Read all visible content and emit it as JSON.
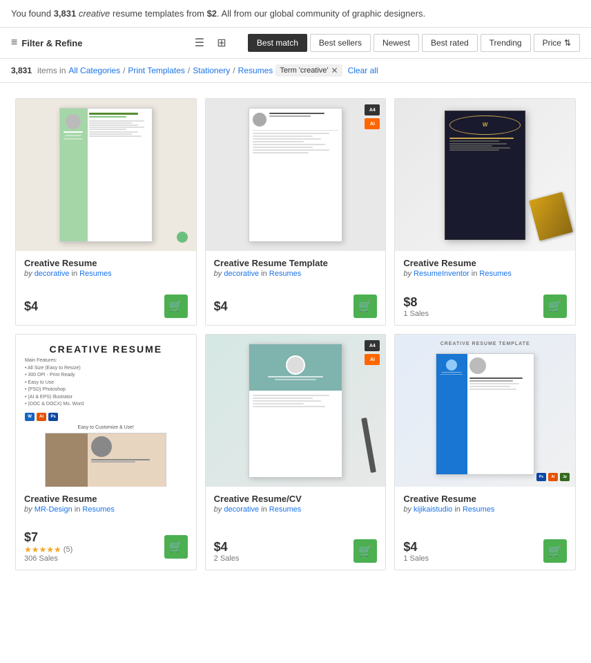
{
  "banner": {
    "found_count": "3,831",
    "term": "creative",
    "price_from": "$2",
    "description_before": "You found ",
    "description_middle": " resume templates from ",
    "description_after": ". All from our global community of graphic designers."
  },
  "toolbar": {
    "filter_label": "Filter & Refine",
    "sort_options": [
      {
        "id": "best_match",
        "label": "Best match",
        "active": true
      },
      {
        "id": "best_sellers",
        "label": "Best sellers",
        "active": false
      },
      {
        "id": "newest",
        "label": "Newest",
        "active": false
      },
      {
        "id": "best_rated",
        "label": "Best rated",
        "active": false
      },
      {
        "id": "trending",
        "label": "Trending",
        "active": false
      },
      {
        "id": "price",
        "label": "Price",
        "active": false
      }
    ]
  },
  "breadcrumb": {
    "count": "3,831",
    "in_label": "items in",
    "links": [
      {
        "label": "All Categories"
      },
      {
        "label": "Print Templates"
      },
      {
        "label": "Stationery"
      },
      {
        "label": "Resumes"
      }
    ],
    "term_label": "Term 'creative'",
    "clear_label": "Clear all"
  },
  "products": [
    {
      "id": "p1",
      "title": "Creative Resume",
      "author": "decorative",
      "category": "Resumes",
      "price": "$4",
      "sales": null,
      "rating": null,
      "review_count": null,
      "thumb_type": "green_sidebar"
    },
    {
      "id": "p2",
      "title": "Creative Resume Template",
      "author": "decorative",
      "category": "Resumes",
      "price": "$4",
      "sales": null,
      "rating": null,
      "review_count": null,
      "thumb_type": "white_clean"
    },
    {
      "id": "p3",
      "title": "Creative Resume",
      "author": "ResumeInventor",
      "category": "Resumes",
      "price": "$8",
      "sales": "1 Sales",
      "rating": null,
      "review_count": null,
      "thumb_type": "dark_gold"
    },
    {
      "id": "p4",
      "title": "Creative Resume",
      "author": "MR-Design",
      "category": "Resumes",
      "price": "$7",
      "sales": "306 Sales",
      "rating": "★★★★★",
      "review_count": "(5)",
      "thumb_type": "white_text"
    },
    {
      "id": "p5",
      "title": "Creative Resume/CV",
      "author": "decorative",
      "category": "Resumes",
      "price": "$4",
      "sales": "2 Sales",
      "rating": null,
      "review_count": null,
      "thumb_type": "teal_photo"
    },
    {
      "id": "p6",
      "title": "Creative Resume",
      "author": "kijikaistudio",
      "category": "Resumes",
      "price": "$4",
      "sales": "1 Sales",
      "rating": null,
      "review_count": null,
      "thumb_type": "blue_multi"
    }
  ],
  "labels": {
    "by": "by",
    "in": "in",
    "add_to_cart": "🛒"
  }
}
